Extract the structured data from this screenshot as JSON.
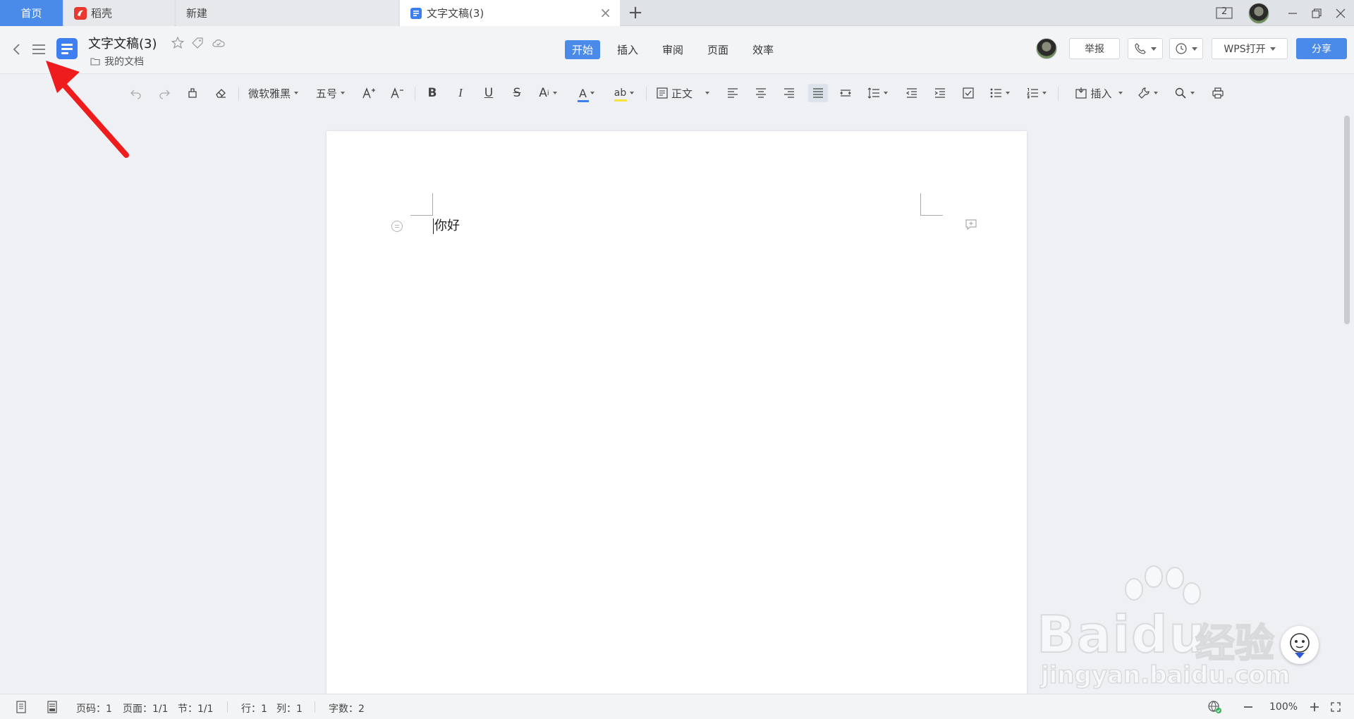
{
  "tabs": {
    "home": "首页",
    "daoke": "稻壳",
    "new": "新建",
    "doc": "文字文稿(3)",
    "badge": "2"
  },
  "title": {
    "doc_name": "文字文稿(3)",
    "folder": "我的文档"
  },
  "menu": [
    "开始",
    "插入",
    "审阅",
    "页面",
    "效率"
  ],
  "right_buttons": {
    "report": "举报",
    "wps_open": "WPS打开",
    "share": "分享"
  },
  "toolbar": {
    "font_name": "微软雅黑",
    "font_size": "五号",
    "style": "正文",
    "insert": "插入",
    "font_color": "#3d7ef0",
    "highlight_color": "#f5e23a"
  },
  "document": {
    "text": "你好"
  },
  "status": {
    "page_code": "页码：1",
    "page": "页面：1/1",
    "section": "节：1/1",
    "row": "行：1",
    "col": "列：1",
    "words": "字数：2",
    "zoom": "100%"
  },
  "watermark": {
    "brand": "Baidu",
    "brand_cn": "经验",
    "url": "jingyan.baidu.com"
  },
  "colors": {
    "accent": "#4a8ae8",
    "annotation_arrow": "#ee1c1c"
  }
}
